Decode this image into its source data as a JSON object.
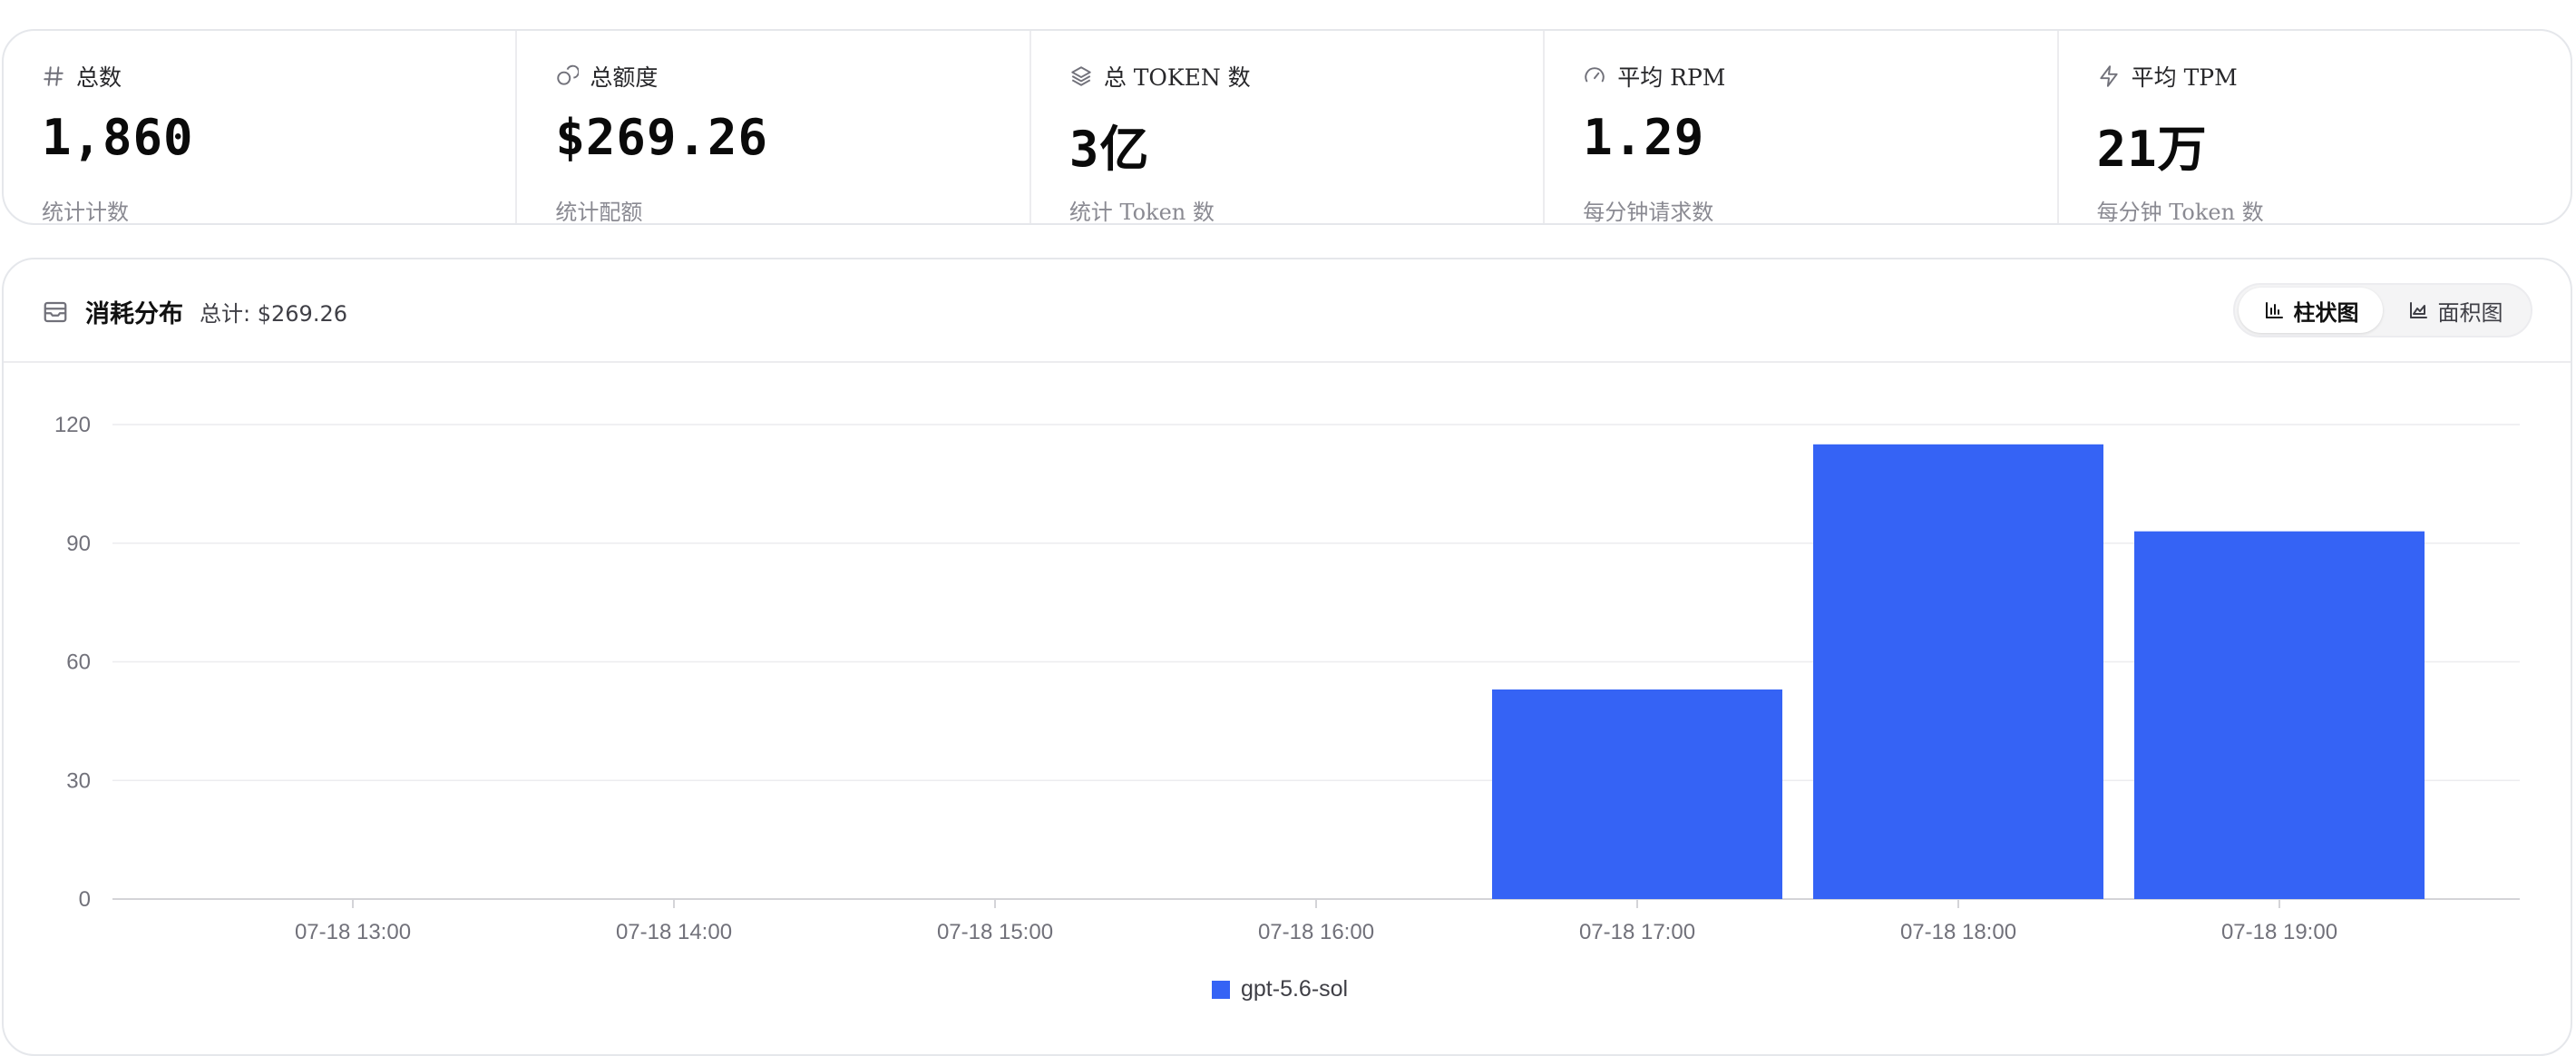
{
  "stats": [
    {
      "icon": "hash-icon",
      "label": "总数",
      "value": "1,860",
      "sub": "统计计数"
    },
    {
      "icon": "coins-icon",
      "label": "总额度",
      "value": "$269.26",
      "sub": "统计配额"
    },
    {
      "icon": "layers-icon",
      "label": "总 TOKEN 数",
      "value": "3亿",
      "sub": "统计 Token 数"
    },
    {
      "icon": "gauge-icon",
      "label": "平均 RPM",
      "value": "1.29",
      "sub": "每分钟请求数"
    },
    {
      "icon": "zap-icon",
      "label": "平均 TPM",
      "value": "21万",
      "sub": "每分钟 Token 数"
    }
  ],
  "panel": {
    "title": "消耗分布",
    "total_label": "总计:",
    "total_value": "$269.26",
    "toggle": {
      "bar": "柱状图",
      "area": "面积图",
      "active": "bar"
    }
  },
  "chart_data": {
    "type": "bar",
    "categories": [
      "07-18 13:00",
      "07-18 14:00",
      "07-18 15:00",
      "07-18 16:00",
      "07-18 17:00",
      "07-18 18:00",
      "07-18 19:00"
    ],
    "series": [
      {
        "name": "gpt-5.6-sol",
        "values": [
          0,
          0,
          0,
          0,
          53,
          115,
          93
        ],
        "color": "#3563f5"
      }
    ],
    "ylim": [
      0,
      120
    ],
    "yticks": [
      0,
      30,
      60,
      90,
      120
    ],
    "grid": true,
    "legend": "bottom-center"
  }
}
